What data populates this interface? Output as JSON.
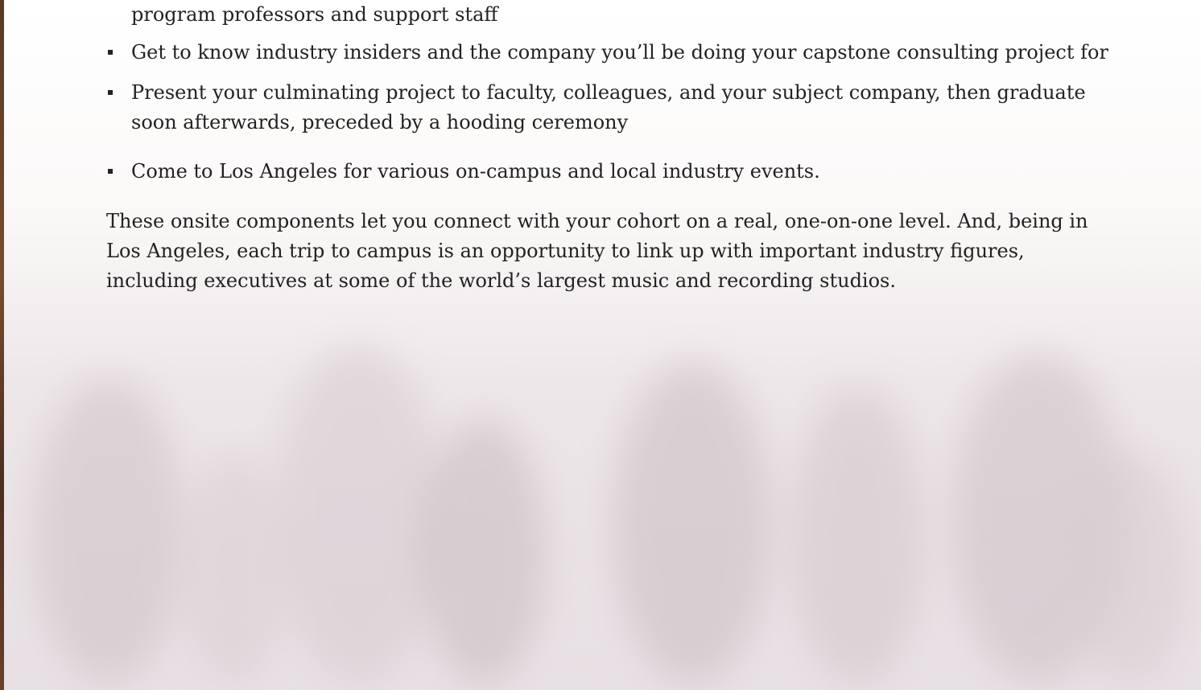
{
  "document": {
    "continued_line": "program professors and support staff",
    "bullets": [
      {
        "text": "Get to know industry insiders and the company you’ll be doing your capstone consulting project for"
      },
      {
        "text": "Present your culminating project to faculty, colleagues, and your subject company, then graduate soon afterwards, preceded by a hooding ceremony"
      },
      {
        "text": "Come to Los Angeles for various on-campus and local industry events."
      }
    ],
    "closing_paragraph": "These onsite components let you connect with your cohort on a real, one-on-one level. And, being in Los Angeles, each trip to campus is an opportunity to link up with important industry figures, including executives at some of the world’s largest music and recording studios."
  },
  "colors": {
    "text": "#222222",
    "background_top": "#ffffff",
    "background_bottom": "#e7e0e4",
    "edge_strip": "#5a3a22"
  }
}
